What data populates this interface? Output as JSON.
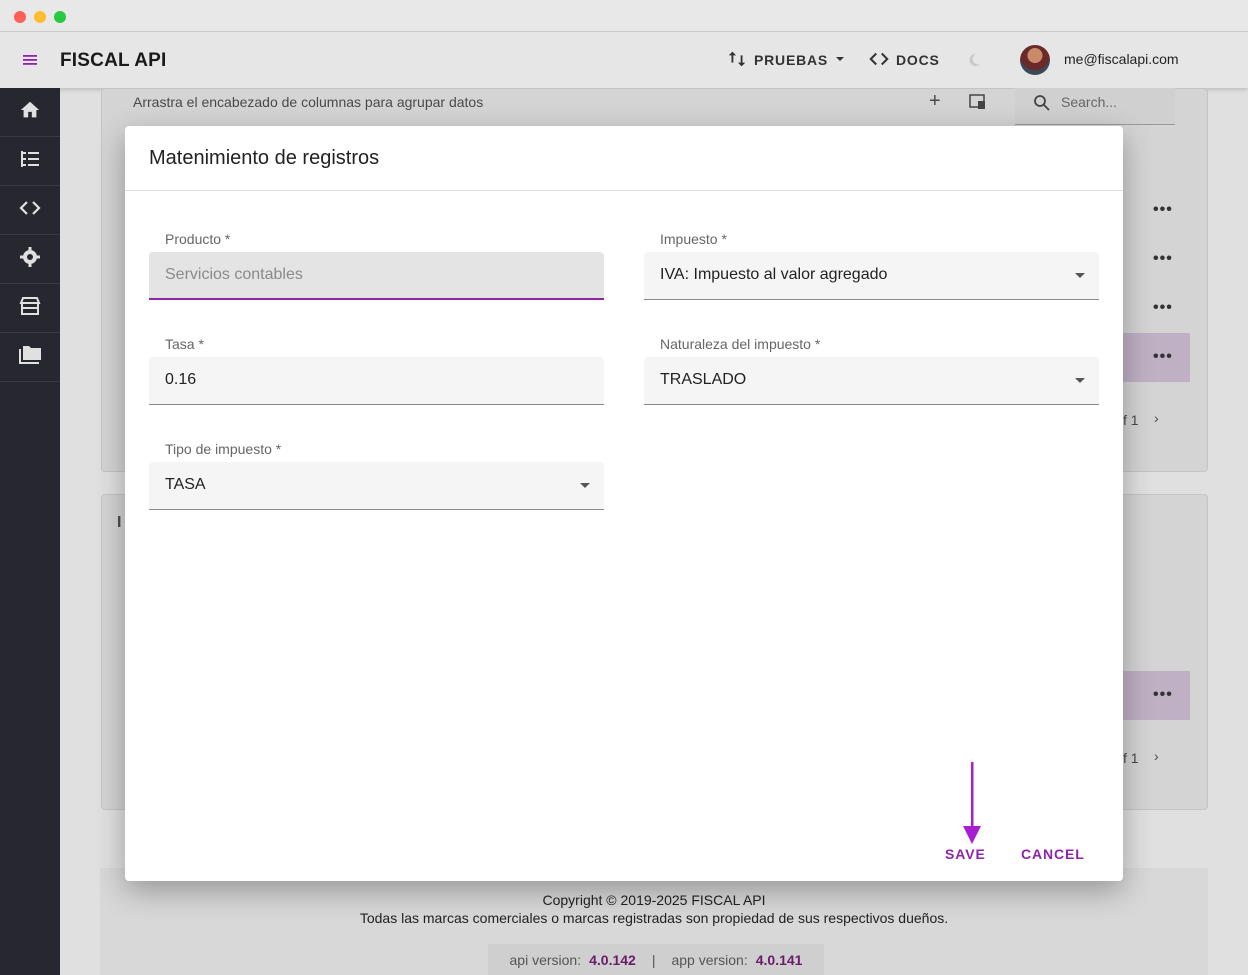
{
  "appbar": {
    "title": "FISCAL API",
    "env_label": "PRUEBAS",
    "docs_label": "DOCS",
    "user_email": "me@fiscalapi.com"
  },
  "sidebar": {
    "items": [
      {
        "icon": "home-icon"
      },
      {
        "icon": "tree-list-icon"
      },
      {
        "icon": "code-icon"
      },
      {
        "icon": "gear-icon"
      },
      {
        "icon": "store-icon"
      },
      {
        "icon": "folder-icon"
      }
    ]
  },
  "background": {
    "group_hint": "Arrastra el encabezado de columnas para agrupar datos",
    "search_placeholder": "Search...",
    "pager_text": "f 1",
    "second_card_title_fragment": "I"
  },
  "dialog": {
    "title": "Matenimiento de registros",
    "fields": {
      "producto": {
        "label": "Producto *",
        "value": "Servicios contables"
      },
      "impuesto": {
        "label": "Impuesto *",
        "value": "IVA: Impuesto al valor agregado"
      },
      "tasa": {
        "label": "Tasa *",
        "value": "0.16"
      },
      "naturaleza": {
        "label": "Naturaleza del impuesto *",
        "value": "TRASLADO"
      },
      "tipo": {
        "label": "Tipo de impuesto *",
        "value": "TASA"
      }
    },
    "save_label": "SAVE",
    "cancel_label": "CANCEL"
  },
  "footer": {
    "copyright": "Copyright © 2019-2025 FISCAL API",
    "trademarks": "Todas las marcas comerciales o marcas registradas son propiedad de sus respectivos dueños.",
    "api_version_label": "api version:",
    "api_version": "4.0.142",
    "separator": "|",
    "app_version_label": "app version:",
    "app_version": "4.0.141"
  },
  "colors": {
    "accent": "#8e24aa",
    "sidebar_bg": "#27272f",
    "appbar_bg": "#e6e6e6"
  }
}
